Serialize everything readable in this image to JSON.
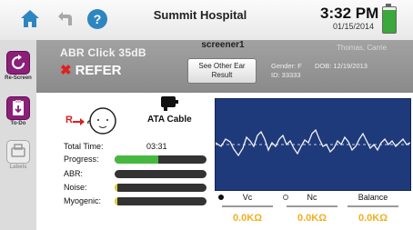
{
  "topbar": {
    "hospital": "Summit Hospital",
    "time": "3:32 PM",
    "date": "01/15/2014",
    "battery_level": 0.9
  },
  "sidebar": {
    "items": [
      {
        "label": "Re-Screen",
        "icon": "rescreen-icon"
      },
      {
        "label": "To-Do",
        "icon": "todo-icon"
      },
      {
        "label": "Labels",
        "icon": "labels-icon"
      }
    ]
  },
  "header": {
    "test_type": "ABR  Click  35dB",
    "result": "REFER",
    "screener": "screener1",
    "other_ear_button": "See Other Ear Result",
    "patient_name": "Thomas, Carrie",
    "gender": "Gender:  F",
    "dob": "DOB:  12/19/2013",
    "id": "ID:  33333"
  },
  "test": {
    "ear": "R",
    "cable": "ATA Cable",
    "total_time_label": "Total Time:",
    "total_time": "03:31",
    "progress_label": "Progress:",
    "abr_label": "ABR:",
    "noise_label": "Noise:",
    "myogenic_label": "Myogenic:",
    "progress": 0.48,
    "abr": 0.0,
    "noise": 0.03,
    "myogenic": 0.03
  },
  "impedance": {
    "vc_label": "Vc",
    "nc_label": "Nc",
    "balance_label": "Balance",
    "vc_value": "0.0KΩ",
    "nc_value": "0.0KΩ",
    "balance_value": "0.0KΩ"
  },
  "colors": {
    "accent": "#8b1f7a",
    "refer": "#e02020",
    "impedance_value": "#f0b020",
    "waveform_bg": "#1f3a7a"
  }
}
